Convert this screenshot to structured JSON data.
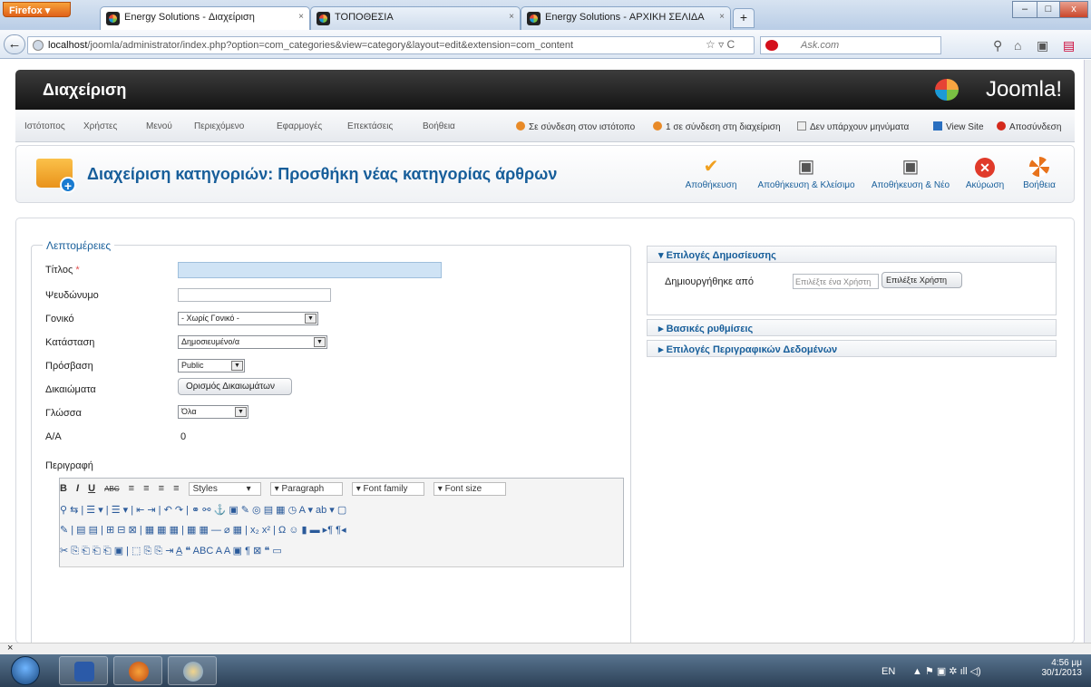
{
  "browser": {
    "menu_label": "Firefox",
    "tabs": [
      {
        "title": "Energy Solutions - Διαχείριση",
        "close": "×"
      },
      {
        "title": "ΤΟΠΟΘΕΣΙΑ",
        "close": "×"
      },
      {
        "title": "Energy Solutions - ΑΡΧΙΚΗ ΣΕΛΙΔΑ",
        "close": "×"
      }
    ],
    "new_tab": "+",
    "url_host": "localhost",
    "url_path": "/joomla/administrator/index.php?option=com_categories&view=category&layout=edit&extension=com_content",
    "search_placeholder": "Ask.com",
    "window_controls": [
      "–",
      "□",
      "x"
    ]
  },
  "header": {
    "title": "Διαχείριση",
    "logo": "Joomla!"
  },
  "menu": {
    "items": [
      "Ιστότοπος",
      "Χρήστες",
      "Μενού",
      "Περιεχόμενο",
      "Εφαρμογές",
      "Επεκτάσεις",
      "Βοήθεια"
    ],
    "status": [
      "Σε σύνδεση στον ιστότοπο",
      "1 σε σύνδεση στη διαχείριση",
      "Δεν υπάρχουν μηνύματα",
      "View Site",
      "Αποσύνδεση"
    ]
  },
  "toolbar": {
    "title": "Διαχείριση κατηγοριών: Προσθήκη νέας κατηγορίας άρθρων",
    "save": "Αποθήκευση",
    "save_close": "Αποθήκευση & Κλείσιμο",
    "save_new": "Αποθήκευση & Νέο",
    "cancel": "Ακύρωση",
    "help": "Βοήθεια"
  },
  "details": {
    "legend": "Λεπτομέρειες",
    "title_label": "Τίτλος",
    "required_mark": "*",
    "alias_label": "Ψευδώνυμο",
    "parent_label": "Γονικό",
    "parent_value": "- Χωρίς Γονικό -",
    "state_label": "Κατάσταση",
    "state_value": "Δημοσιευμένο/α",
    "access_label": "Πρόσβαση",
    "access_value": "Public",
    "perm_label": "Δικαιώματα",
    "perm_button": "Ορισμός Δικαιωμάτων",
    "lang_label": "Γλώσσα",
    "lang_value": "Όλα",
    "id_label": "A/A",
    "id_value": "0",
    "desc_label": "Περιγραφή"
  },
  "editor": {
    "row1": [
      "B",
      "I",
      "U",
      "ABC",
      "≡",
      "≡",
      "≡",
      "≡"
    ],
    "styles": "Styles",
    "paragraph": "Paragraph",
    "font_family": "Font family",
    "font_size": "Font size",
    "row2": "⚲ ⇆ | ☰ ▾ | ☰ ▾ | ⇤ ⇥ | ↶ ↷ | ⚭ ⚯ ⚓ ▣ ✎ ◎ ▤ ▦ ◷ A ▾ ab ▾ ▢",
    "row3": "✎ | ▤ ▤ | ⊞ ⊟ ⊠ | ▦ ▦ ▦ | ▦ ▦ — ⌀ ▦ | x₂ x² | Ω ☺ ▮ ▬ ▸¶ ¶◂",
    "row4": "✂ ⎘ ⎗ ⎗ ⎗ ▣ | ⬚ ⎘ ⎘ ⇥ A̲ ❝ ABC A A ▣ ¶ ⊠ ❝ ▭"
  },
  "publish": {
    "header": "▾ Επιλογές Δημοσίευσης",
    "created_by_label": "Δημιουργήθηκε από",
    "user_placeholder": "Επιλέξτε ένα Χρήστη",
    "user_button": "Επιλέξτε Χρήστη"
  },
  "panels": [
    "▸ Βασικές ρυθμίσεις",
    "▸ Επιλογές Περιγραφικών Δεδομένων"
  ],
  "taskbar": {
    "close": "×",
    "lang": "EN",
    "time": "4:56 μμ",
    "date": "30/1/2013"
  },
  "colors": {
    "accent": "#175e9a",
    "header_bg": "#1c1c1c",
    "save": "#f0a020",
    "cancel": "#e03a2a"
  }
}
